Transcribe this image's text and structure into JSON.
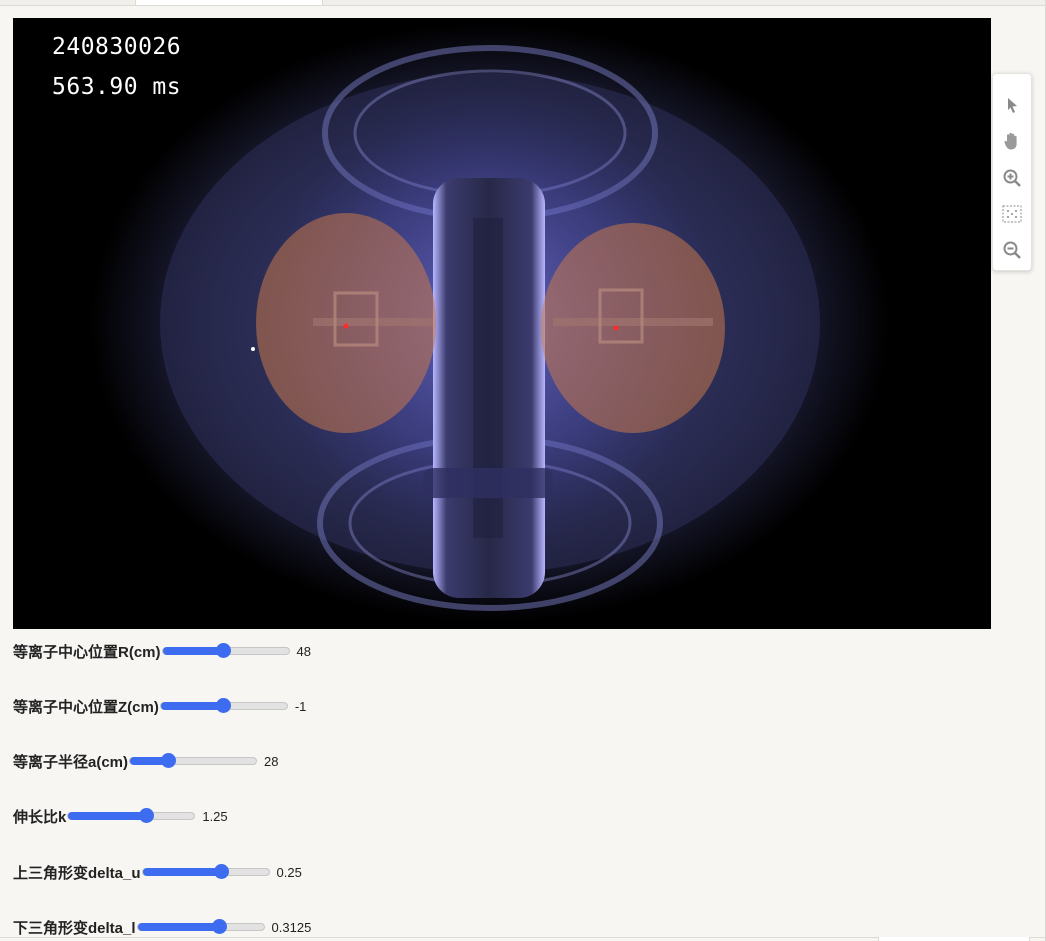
{
  "viewer": {
    "shot_number": "240830026",
    "time_label": "563.90 ms"
  },
  "toolbar": {
    "tools": [
      {
        "name": "pointer-icon"
      },
      {
        "name": "pan-hand-icon"
      },
      {
        "name": "zoom-in-icon"
      },
      {
        "name": "zoom-to-fit-icon"
      },
      {
        "name": "zoom-out-icon"
      }
    ]
  },
  "controls": [
    {
      "label": "等离子中心位置R(cm)",
      "value": "48",
      "fraction": 0.48
    },
    {
      "label": "等离子中心位置Z(cm)",
      "value": "-1",
      "fraction": 0.49
    },
    {
      "label": "等离子半径a(cm)",
      "value": "28",
      "fraction": 0.3
    },
    {
      "label": "伸长比k",
      "value": "1.25",
      "fraction": 0.62
    },
    {
      "label": "上三角形变delta_u",
      "value": "0.25",
      "fraction": 0.62
    },
    {
      "label": "下三角形变delta_l",
      "value": "0.3125",
      "fraction": 0.65
    }
  ],
  "colors": {
    "slider_accent": "#3d6cf0",
    "plasma_overlay": "#c8784a"
  }
}
